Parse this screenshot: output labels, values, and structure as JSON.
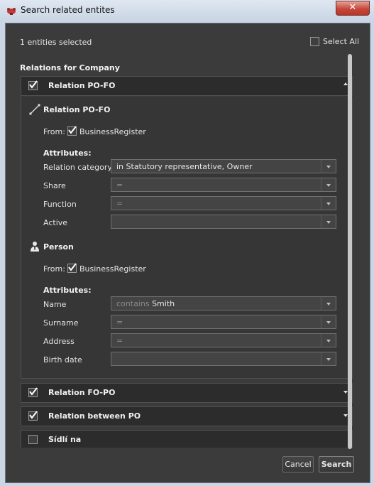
{
  "window": {
    "title": "Search related entites",
    "close_label": "✕"
  },
  "header": {
    "selected_text": "1 entities selected",
    "select_all_label": "Select All",
    "select_all_checked": false
  },
  "section_title": "Relations for Company",
  "relations": [
    {
      "label": "Relation PO-FO",
      "checked": true,
      "expanded": true,
      "relation_block": {
        "title": "Relation PO-FO",
        "from_label": "From:",
        "from_value": "BusinessRegister",
        "attributes_label": "Attributes:",
        "attributes": [
          {
            "label": "Relation category",
            "placeholder": "",
            "value": "in Statutory representative, Owner"
          },
          {
            "label": "Share",
            "placeholder": "=",
            "value": ""
          },
          {
            "label": "Function",
            "placeholder": "=",
            "value": ""
          },
          {
            "label": "Active",
            "placeholder": "",
            "value": ""
          }
        ]
      },
      "person_block": {
        "title": "Person",
        "from_label": "From:",
        "from_value": "BusinessRegister",
        "attributes_label": "Attributes:",
        "attributes": [
          {
            "label": "Name",
            "placeholder": "contains",
            "value": "Smith"
          },
          {
            "label": "Surname",
            "placeholder": "=",
            "value": ""
          },
          {
            "label": "Address",
            "placeholder": "=",
            "value": ""
          },
          {
            "label": "Birth date",
            "placeholder": "",
            "value": ""
          }
        ]
      }
    },
    {
      "label": "Relation FO-PO",
      "checked": true,
      "expanded": false
    },
    {
      "label": "Relation between PO",
      "checked": true,
      "expanded": false
    },
    {
      "label": "Sídlí na",
      "checked": false,
      "expanded": false
    }
  ],
  "footer": {
    "cancel_label": "Cancel",
    "search_label": "Search"
  }
}
